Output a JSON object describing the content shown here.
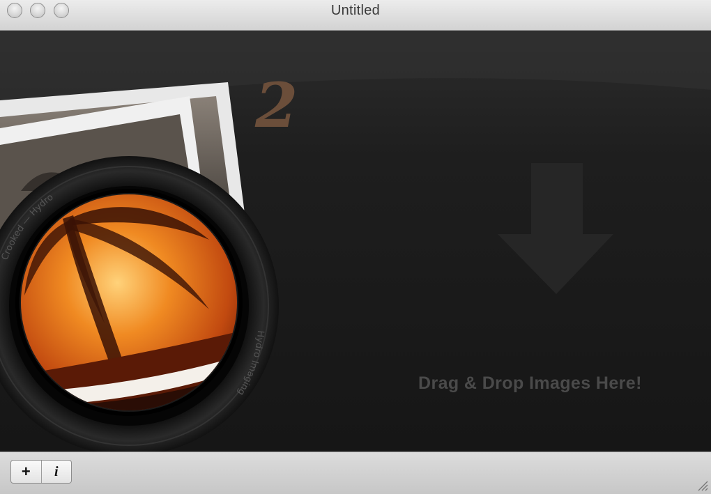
{
  "window": {
    "title": "Untitled"
  },
  "drop_area": {
    "instruction": "Drag & Drop Images Here!",
    "badge_number": "2",
    "lens_ring_top_text": "Crooked — Hydro",
    "lens_ring_bottom_text": "Hydro Imaging",
    "arrow_icon": "down-arrow-icon"
  },
  "toolbar": {
    "add_label": "+",
    "info_label": "i"
  },
  "colors": {
    "drop_text": "#4a4a4a",
    "badge": "#6b4e3a",
    "sunset_orange": "#e2771e"
  }
}
